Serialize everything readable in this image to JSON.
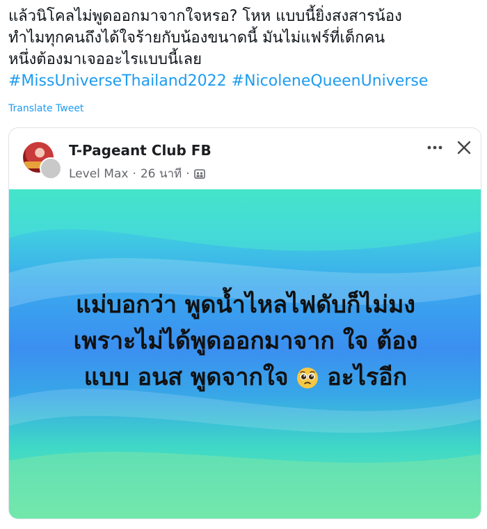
{
  "tweet": {
    "text_lines": [
      "แล้วนิโคลไม่พูดออกมาจากใจหรอ? โหห แบบนี้ยิ่งสงสารน้อง",
      "ทำไมทุกคนถึงได้ใจร้ายกับน้องขนาดนี้ มันไม่แฟร์ที่เด็กคน",
      "หนึ่งต้องมาเจออะไรแบบนี้เลย"
    ],
    "hashtags": [
      "#MissUniverseThailand2022",
      "#NicoleneQueenUniverse"
    ],
    "translate_label": "Translate Tweet"
  },
  "post": {
    "page_name": "T-Pageant Club FB",
    "author": "Level Max",
    "separator": "·",
    "time": "26 นาที",
    "audience_icon": "group-audience-icon",
    "more_icon": "more-horizontal-icon",
    "close_icon": "close-icon",
    "image_text_lines": [
      "แม่บอกว่า พูดน้ำไหลไฟดับก็ไม่มง",
      "เพราะไม่ได้พูดออกมาจาก ใจ ต้อง",
      "แบบ อนส พูดจากใจ",
      "อะไรอีก"
    ],
    "emoji": "pleading-face-emoji"
  },
  "colors": {
    "hashtag": "#1d9bf0",
    "image_gradient_top": "#3fe3c1",
    "image_gradient_mid": "#3b8ff0",
    "image_gradient_bottom": "#6aeab0"
  }
}
